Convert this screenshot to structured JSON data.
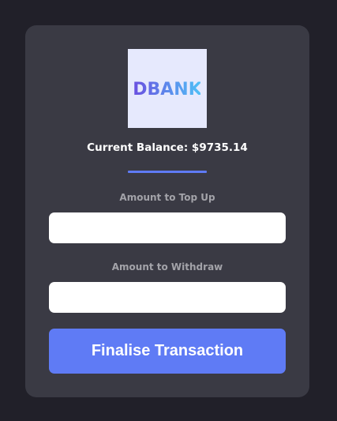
{
  "brand": {
    "logo_text": "DBANK",
    "logo_background": "#e6e9fd",
    "logo_gradient": [
      "#6a4fe0",
      "#4fc3f7"
    ]
  },
  "balance": {
    "text": "Current Balance: $9735.14"
  },
  "form": {
    "topup_label": "Amount to Top Up",
    "topup_value": "",
    "withdraw_label": "Amount to Withdraw",
    "withdraw_value": "",
    "submit_label": "Finalise Transaction"
  },
  "colors": {
    "page_background": "#212029",
    "card_background": "#3a3a44",
    "accent": "#5f7bf5",
    "label_text": "#a3a3a9"
  }
}
